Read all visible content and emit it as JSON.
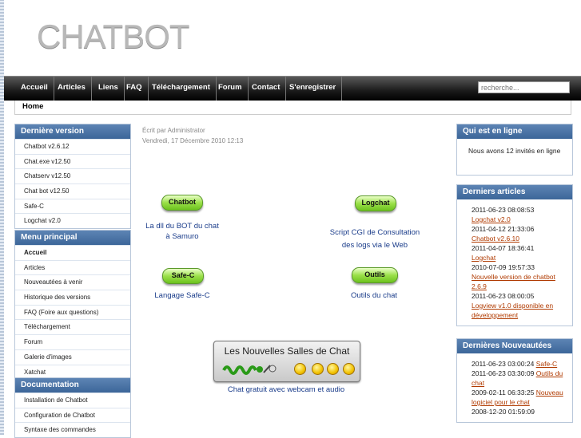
{
  "site": {
    "logo": "CHATBOT"
  },
  "nav": {
    "items": [
      "Accueil",
      "Articles",
      "Liens",
      "FAQ",
      "Téléchargement",
      "Forum",
      "Contact",
      "S'enregistrer"
    ],
    "search_placeholder": "recherche..."
  },
  "breadcrumb": "Home",
  "left": {
    "latest": {
      "title": "Dernière version",
      "items": [
        "Chatbot v2.6.12",
        "Chat.exe v12.50",
        "Chatserv v12.50",
        "Chat bot v12.50",
        "Safe-C",
        "Logchat v2.0"
      ]
    },
    "main_menu": {
      "title": "Menu principal",
      "items": [
        "Accueil",
        "Articles",
        "Nouveautées à venir",
        "Historique des versions",
        "FAQ (Foire aux questions)",
        "Téléchargement",
        "Forum",
        "Galerie d'images",
        "Xatchat"
      ]
    },
    "docs": {
      "title": "Documentation",
      "items": [
        "Installation de Chatbot",
        "Configuration de Chatbot",
        "Syntaxe des commandes"
      ]
    }
  },
  "article": {
    "author": "Écrit par Administrator",
    "date": "Vendredi, 17 Décembre 2010 12:13",
    "buttons": [
      {
        "label": "Chatbot",
        "caption1": "La dll du BOT du chat",
        "caption2": "à Samuro"
      },
      {
        "label": "Logchat",
        "caption1": "Script CGI de Consultation",
        "caption2": "des logs via le Web"
      },
      {
        "label": "Safe-C",
        "caption1": "Langage Safe-C",
        "caption2": ""
      },
      {
        "label": "Outils",
        "caption1": "Outils du chat",
        "caption2": ""
      }
    ],
    "banner_title": "Les Nouvelles Salles de Chat",
    "banner_caption": "Chat gratuit avec webcam et audio"
  },
  "right": {
    "online": {
      "title": "Qui est en ligne",
      "text": "Nous avons 12 invités en ligne"
    },
    "articles": {
      "title": "Derniers articles",
      "entries": [
        {
          "date": "2011-06-23 08:08:53",
          "link": "Logchat v2.0"
        },
        {
          "date": "2011-04-12 21:33:06",
          "link": "Chatbot v2.6.10"
        },
        {
          "date": "2011-04-07 18:36:41",
          "link": "Logchat"
        },
        {
          "date": "2010-07-09 19:57:33",
          "link": "Nouvelle version de chatbot 2.6.9"
        },
        {
          "date": "2011-06-23 08:00:05",
          "link": "Logview v1.0 disponible en développement"
        }
      ]
    },
    "news": {
      "title": "Dernières Nouveautées",
      "entries": [
        {
          "date": "2011-06-23 03:00:24",
          "link": "Safe-C"
        },
        {
          "date": "2011-06-23 03:30:09",
          "link": "Outils du chat"
        },
        {
          "date": "2009-02-11 06:33:25",
          "link": "Nouveau logiciel pour le chat"
        },
        {
          "date": "2008-12-20 01:59:09",
          "link": ""
        }
      ]
    }
  }
}
